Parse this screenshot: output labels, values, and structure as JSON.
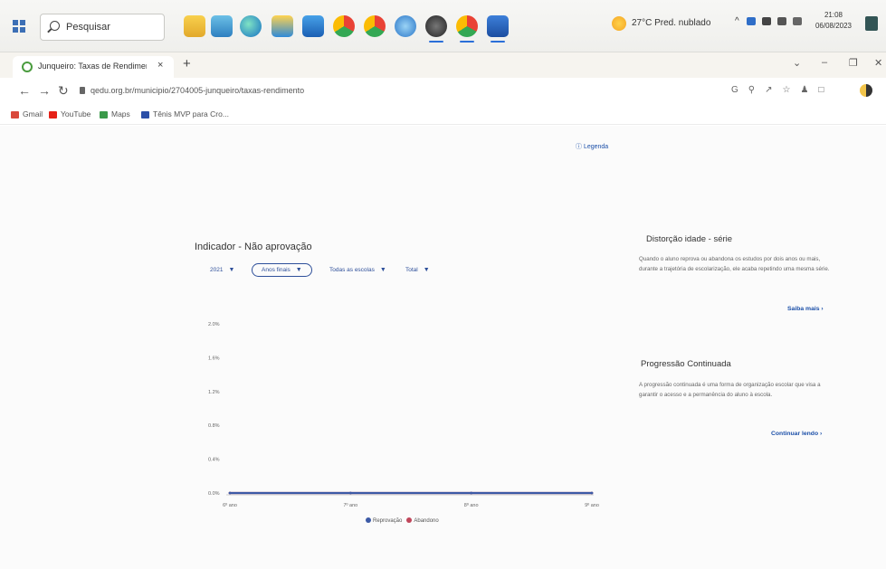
{
  "taskbar": {
    "search_placeholder": "Pesquisar",
    "weather": "27°C Pred. nublado",
    "tray_text": "^",
    "time": "21:08",
    "date": "06/08/2023",
    "apps": [
      "file-explorer-icon",
      "edge-icon",
      "files-icon",
      "mail-icon",
      "chrome-icon",
      "chrome-icon",
      "app-icon",
      "obs-icon",
      "chrome-icon",
      "word-icon"
    ]
  },
  "browser": {
    "tab_title": "Junqueiro: Taxas de Rendimento",
    "tab_close": "×",
    "new_tab": "+",
    "url": "qedu.org.br/municipio/2704005-junqueiro/taxas-rendimento",
    "bookmarks": [
      "Gmail",
      "YouTube",
      "Maps",
      "Tênis MVP para Cro..."
    ]
  },
  "page": {
    "legend_link": "Legenda",
    "indicator_title": "Indicador - Não aprovação",
    "filters": {
      "year": "2021",
      "stage": "Anos finais",
      "schools": "Todas as escolas",
      "network": "Total"
    }
  },
  "chart_data": {
    "type": "line",
    "categories": [
      "6º ano",
      "7º ano",
      "8º ano",
      "9º ano"
    ],
    "series": [
      {
        "name": "Reprovação",
        "values": [
          0,
          0,
          0,
          0
        ],
        "color": "#3c5aa6"
      },
      {
        "name": "Abandono",
        "values": [
          0,
          0,
          0,
          0
        ],
        "color": "#c0465a"
      }
    ],
    "y_ticks": [
      "0.0%",
      "0.4%",
      "0.8%",
      "1.2%",
      "1.6%",
      "2.0%"
    ],
    "ylim": [
      0,
      2.0
    ],
    "grid": false,
    "legend_position": "bottom"
  },
  "side": {
    "distorcao": {
      "title": "Distorção idade - série",
      "text": "Quando o aluno reprova ou abandona os estudos por dois anos ou mais, durante a trajetória de escolarização, ele acaba repetindo uma mesma série.",
      "link": "Saiba mais"
    },
    "progressao": {
      "title": "Progressão Continuada",
      "text": "A progressão continuada é uma forma de organização escolar que visa a garantir o acesso e a permanência do aluno à escola.",
      "link": "Continuar lendo"
    }
  }
}
